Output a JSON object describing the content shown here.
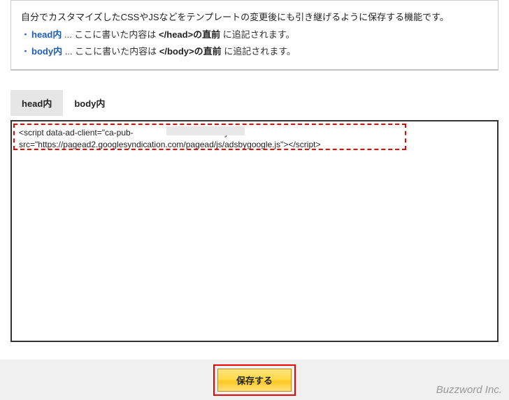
{
  "info": {
    "title": "自分でカスタマイズしたCSSやJSなどをテンプレートの変更後にも引き継げるように保存する機能です。",
    "items": [
      {
        "term": "head内",
        "sep": " ... ",
        "pre": "ここに書いた内容は ",
        "tag": "</head>の直前",
        "post": " に追記されます。"
      },
      {
        "term": "body内",
        "sep": " ... ",
        "pre": "ここに書いた内容は ",
        "tag": "</body>の直前",
        "post": " に追記されます。"
      }
    ]
  },
  "tabs": {
    "head": "head内",
    "body": "body内"
  },
  "textarea": {
    "value": "<script data-ad-client=\"ca-pub-                                 \" async\nsrc=\"https://pagead2.googlesyndication.com/pagead/js/adsbygoogle.js\"></script>"
  },
  "footer": {
    "save_label": "保存する",
    "brand": "Buzzword Inc."
  }
}
